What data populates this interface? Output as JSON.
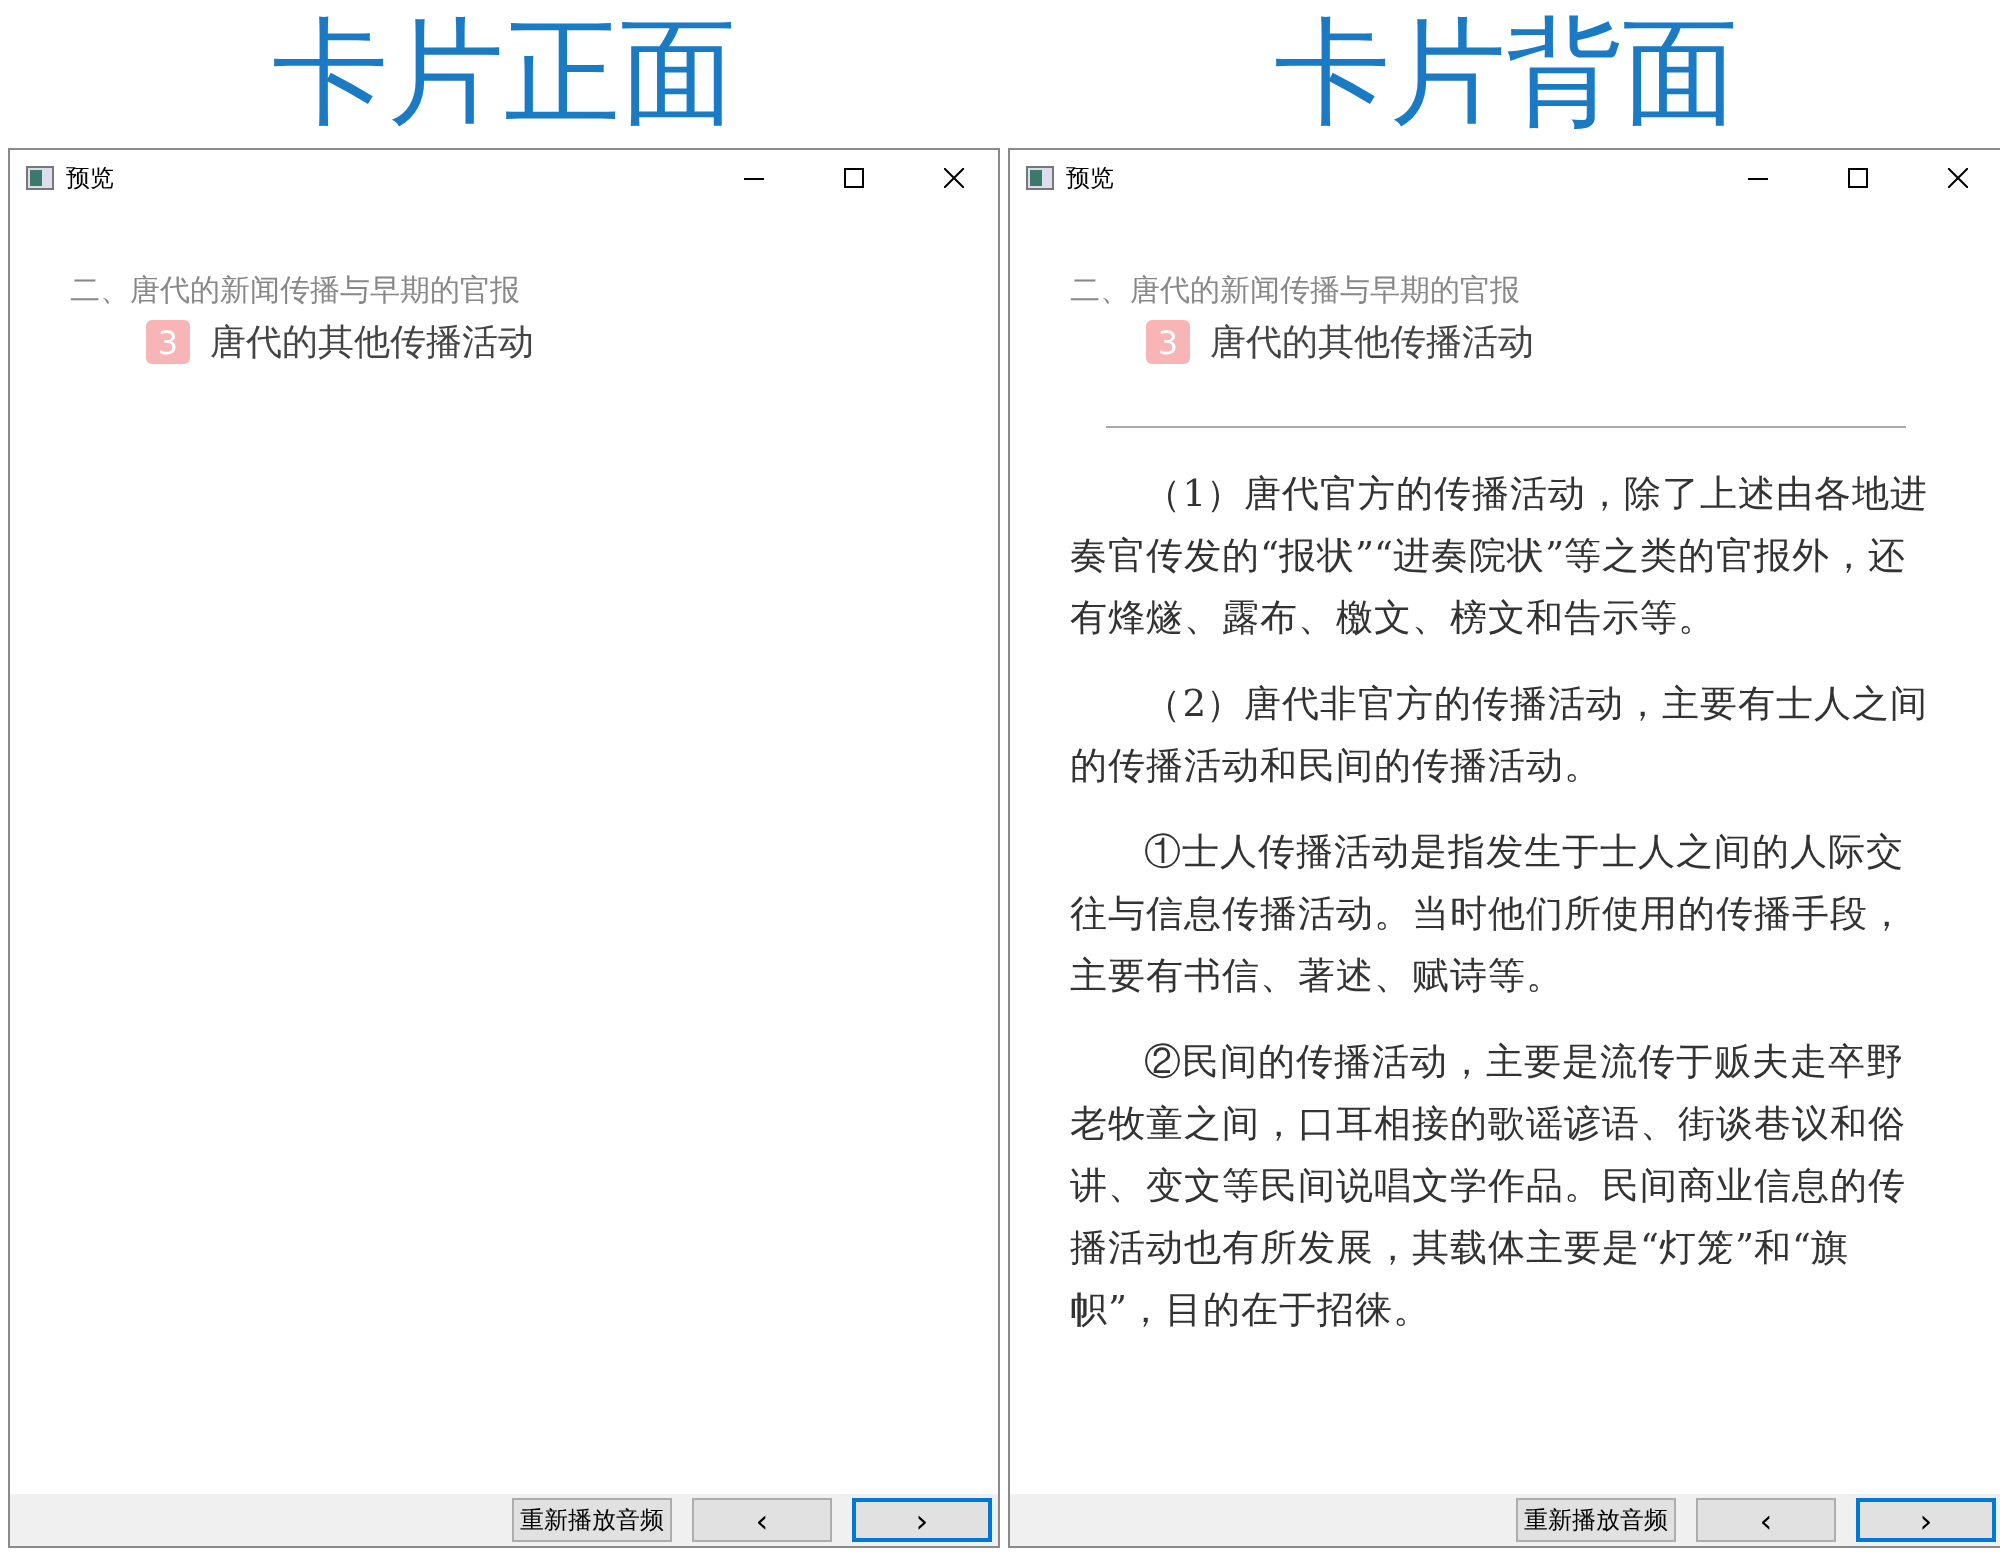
{
  "cards": [
    {
      "heading": "卡片正面",
      "window": {
        "title": "预览"
      },
      "breadcrumb": "二、唐代的新闻传播与早期的官报",
      "badge": "3",
      "section_title": "唐代的其他传播活动",
      "buttons": [
        {
          "label": "重新播放音频",
          "focused": false
        },
        {
          "label": "‹",
          "focused": false
        },
        {
          "label": "›",
          "focused": true
        }
      ]
    },
    {
      "heading": "卡片背面",
      "window": {
        "title": "预览"
      },
      "breadcrumb": "二、唐代的新闻传播与早期的官报",
      "badge": "3",
      "section_title": "唐代的其他传播活动",
      "divider": true,
      "paragraphs": [
        "（1）唐代官方的传播活动，除了上述由各地进奏官传发的“报状”“进奏院状”等之类的官报外，还有烽燧、露布、檄文、榜文和告示等。",
        "（2）唐代非官方的传播活动，主要有士人之间的传播活动和民间的传播活动。",
        "①士人传播活动是指发生于士人之间的人际交往与信息传播活动。当时他们所使用的传播手段，主要有书信、著述、赋诗等。",
        "②民间的传播活动，主要是流传于贩夫走卒野老牧童之间，口耳相接的歌谣谚语、街谈巷议和俗讲、变文等民间说唱文学作品。民间商业信息的传播活动也有所发展，其载体主要是“灯笼”和“旗帜”，目的在于招徕。"
      ],
      "buttons": [
        {
          "label": "重新播放音频",
          "focused": false
        },
        {
          "label": "‹",
          "focused": false
        },
        {
          "label": "›",
          "focused": true
        }
      ]
    }
  ]
}
